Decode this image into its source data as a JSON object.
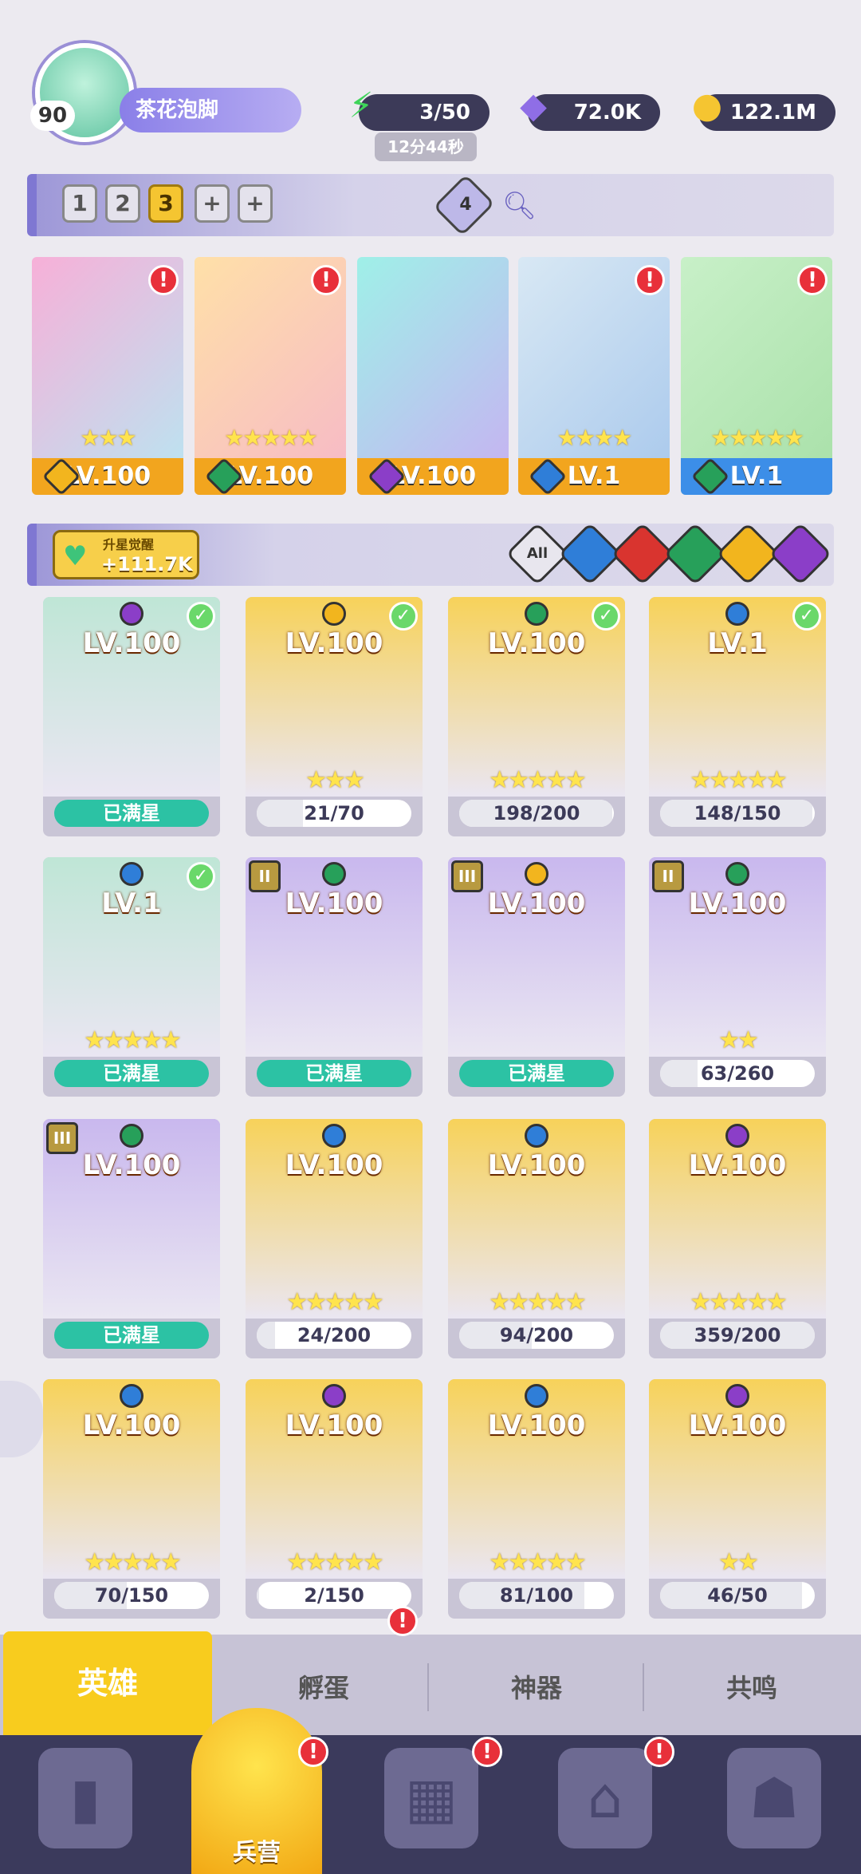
{
  "profile": {
    "level": "90",
    "name": "茶花泡脚"
  },
  "resources": {
    "energy": {
      "value": "3/50",
      "timer": "12分44秒"
    },
    "gems": {
      "value": "72.0K"
    },
    "coins": {
      "value": "122.1M"
    }
  },
  "team_tabs": [
    "1",
    "2",
    "3",
    "+",
    "+"
  ],
  "team_active": "3",
  "team_slots_count": "4",
  "team": [
    {
      "level": "LV.100",
      "stars": "★★★",
      "element_color": "#f2b51e",
      "bar_color": "#f2a51e"
    },
    {
      "level": "LV.100",
      "stars": "★★★★★",
      "element_color": "#27a05a",
      "bar_color": "#f2a51e"
    },
    {
      "level": "LV.100",
      "stars": "",
      "element_color": "#8b3ec8",
      "bar_color": "#f2a51e"
    },
    {
      "level": "LV.1",
      "stars": "★★★★",
      "element_color": "#2f7ed8",
      "bar_color": "#f2a51e"
    },
    {
      "level": "LV.1",
      "stars": "★★★★★",
      "element_color": "#27a05a",
      "bar_color": "#3c8ee8"
    }
  ],
  "awaken": {
    "label": "升星觉醒",
    "value": "+111.7K"
  },
  "filters": [
    "All"
  ],
  "heroes": [
    {
      "level": "LV.100",
      "stars": "",
      "progress": "已满星",
      "full": true,
      "check": true,
      "rank": "",
      "gem": "#8b3ec8",
      "bg": "#bfe6d6"
    },
    {
      "level": "LV.100",
      "stars": "★★★",
      "progress": "21/70",
      "full": false,
      "check": true,
      "rank": "",
      "gem": "#f2b51e",
      "bg": "#f7d25a"
    },
    {
      "level": "LV.100",
      "stars": "★★★★★",
      "progress": "198/200",
      "full": false,
      "check": true,
      "rank": "",
      "gem": "#27a05a",
      "bg": "#f7d25a"
    },
    {
      "level": "LV.1",
      "stars": "★★★★★",
      "progress": "148/150",
      "full": false,
      "check": true,
      "rank": "",
      "gem": "#2f7ed8",
      "bg": "#f7d25a"
    },
    {
      "level": "LV.1",
      "stars": "★★★★★",
      "progress": "已满星",
      "full": true,
      "check": true,
      "rank": "",
      "gem": "#2f7ed8",
      "bg": "#bfe6d6"
    },
    {
      "level": "LV.100",
      "stars": "",
      "progress": "已满星",
      "full": true,
      "check": false,
      "rank": "II",
      "gem": "#27a05a",
      "bg": "#c9b8ee"
    },
    {
      "level": "LV.100",
      "stars": "",
      "progress": "已满星",
      "full": true,
      "check": false,
      "rank": "III",
      "gem": "#f2b51e",
      "bg": "#c9b8ee"
    },
    {
      "level": "LV.100",
      "stars": "★★",
      "progress": "63/260",
      "full": false,
      "check": false,
      "rank": "II",
      "gem": "#27a05a",
      "bg": "#c9b8ee"
    },
    {
      "level": "LV.100",
      "stars": "",
      "progress": "已满星",
      "full": true,
      "check": false,
      "rank": "III",
      "gem": "#27a05a",
      "bg": "#c9b8ee"
    },
    {
      "level": "LV.100",
      "stars": "★★★★★",
      "progress": "24/200",
      "full": false,
      "check": false,
      "rank": "",
      "gem": "#2f7ed8",
      "bg": "#f7d25a"
    },
    {
      "level": "LV.100",
      "stars": "★★★★★",
      "progress": "94/200",
      "full": false,
      "check": false,
      "rank": "",
      "gem": "#2f7ed8",
      "bg": "#f7d25a"
    },
    {
      "level": "LV.100",
      "stars": "★★★★★",
      "progress": "359/200",
      "full": false,
      "check": false,
      "rank": "",
      "gem": "#8b3ec8",
      "bg": "#f7d25a"
    },
    {
      "level": "LV.100",
      "stars": "★★★★★",
      "progress": "70/150",
      "full": false,
      "check": false,
      "rank": "",
      "gem": "#2f7ed8",
      "bg": "#f7d25a"
    },
    {
      "level": "LV.100",
      "stars": "★★★★★",
      "progress": "2/150",
      "full": false,
      "check": false,
      "rank": "",
      "gem": "#8b3ec8",
      "bg": "#f7d25a"
    },
    {
      "level": "LV.100",
      "stars": "★★★★★",
      "progress": "81/100",
      "full": false,
      "check": false,
      "rank": "",
      "gem": "#2f7ed8",
      "bg": "#f7d25a"
    },
    {
      "level": "LV.100",
      "stars": "★★",
      "progress": "46/50",
      "full": false,
      "check": false,
      "rank": "",
      "gem": "#8b3ec8",
      "bg": "#f7d25a"
    }
  ],
  "tabs": [
    "英雄",
    "孵蛋",
    "神器",
    "共鸣"
  ],
  "nav": {
    "barracks_label": "兵营"
  }
}
